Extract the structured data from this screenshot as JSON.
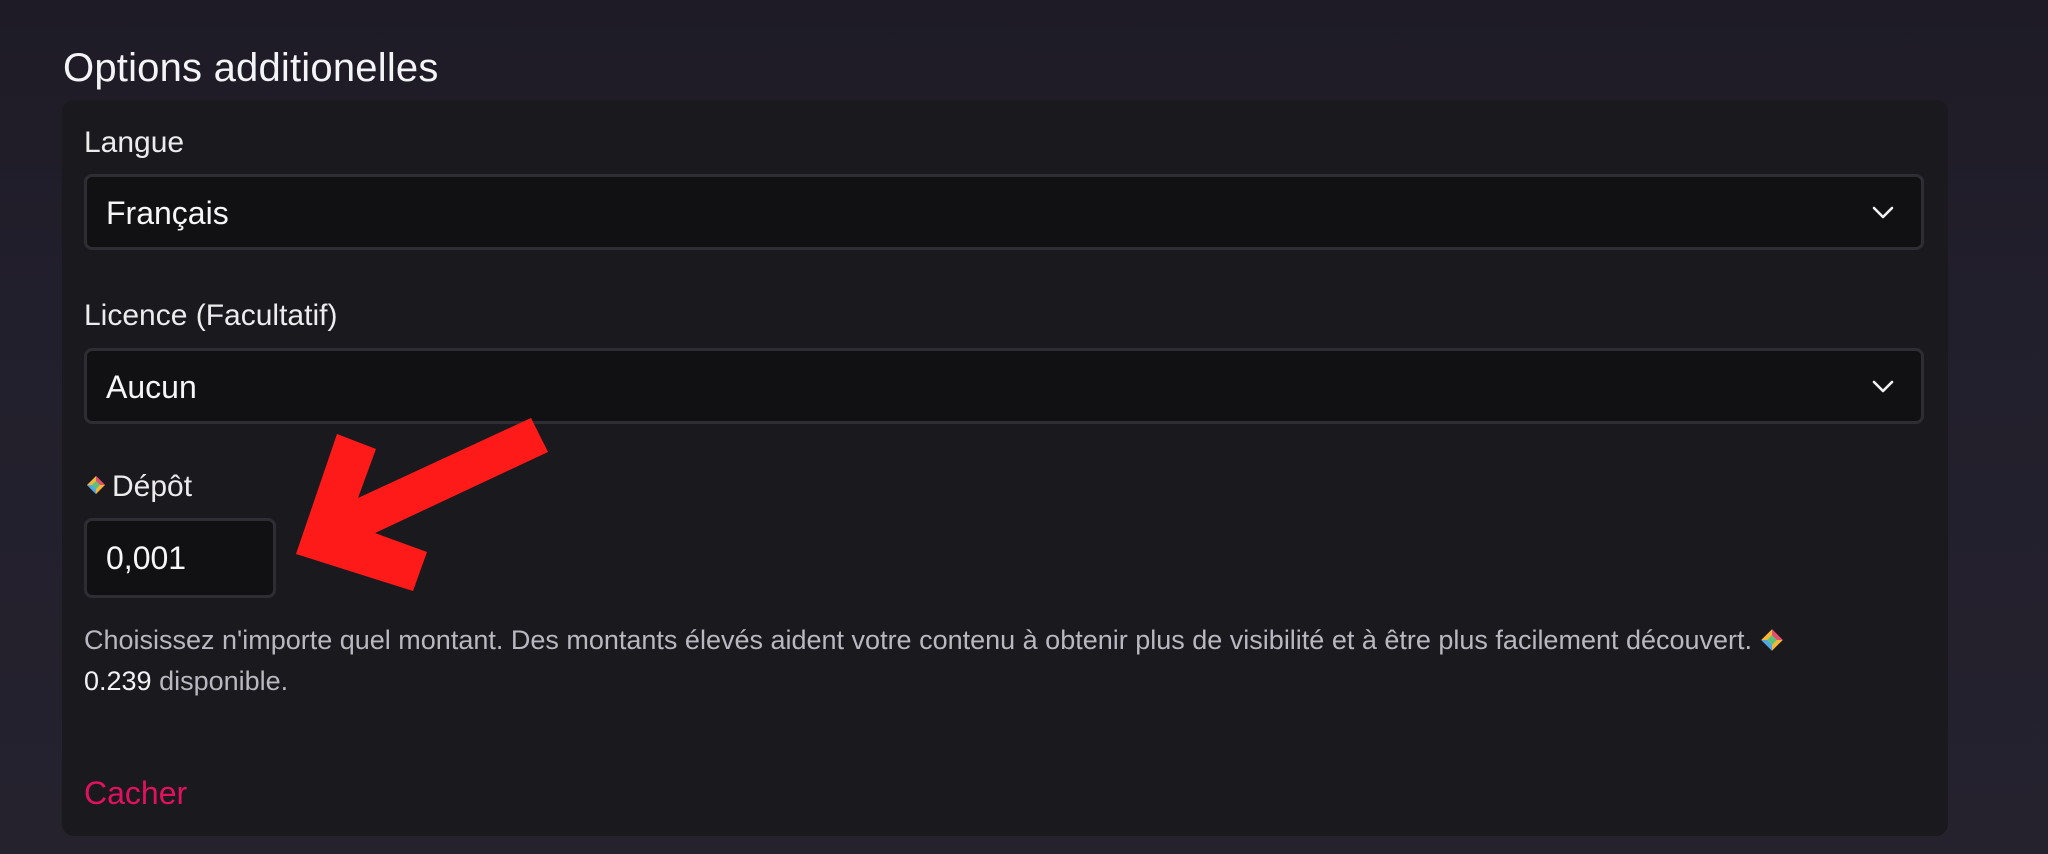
{
  "section": {
    "title": "Options additionelles"
  },
  "language": {
    "label": "Langue",
    "selected": "Français"
  },
  "license": {
    "label": "Licence (Facultatif)",
    "selected": "Aucun"
  },
  "deposit": {
    "icon": "lbc-credits-icon",
    "label": "Dépôt",
    "value": "0,001",
    "help_text": "Choisissez n'importe quel montant. Des montants élevés aident votre contenu à obtenir plus de visibilité et à être plus facilement découvert.",
    "available_amount": "0.239",
    "available_suffix": "disponible."
  },
  "actions": {
    "hide_label": "Cacher"
  },
  "colors": {
    "accent_link": "#e0115f",
    "annotation_arrow": "#ff1a1a"
  }
}
